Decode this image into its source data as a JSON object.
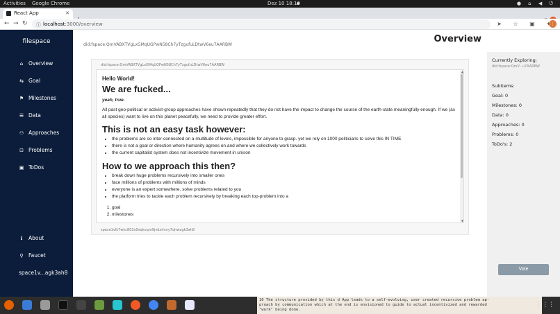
{
  "os": {
    "activities": "Activities",
    "app_name": "Google Chrome",
    "clock": "Dez 10  18:10"
  },
  "browser": {
    "tab_title": "React App",
    "url_host": "localhost",
    "url_path": ":3000/overview"
  },
  "sidebar": {
    "brand": "filespace",
    "items": [
      {
        "label": "Overview",
        "icon": "home-icon"
      },
      {
        "label": "Goal",
        "icon": "goal-icon"
      },
      {
        "label": "Milestones",
        "icon": "milestones-icon"
      },
      {
        "label": "Data",
        "icon": "data-icon"
      },
      {
        "label": "Approaches",
        "icon": "approaches-icon"
      },
      {
        "label": "Problems",
        "icon": "problems-icon"
      },
      {
        "label": "ToDos",
        "icon": "todos-icon"
      }
    ],
    "bottom": [
      {
        "label": "About",
        "icon": "info-icon"
      },
      {
        "label": "Faucet",
        "icon": "faucet-icon"
      }
    ],
    "account": "space1v...agk3ah8"
  },
  "header": {
    "did": "did:fspace:QmVABXTVgLxGMqUGPwN58Ch7yTzgufuLDtwV6eu7AARBW",
    "title": "Overview"
  },
  "card": {
    "did": "did:fspace:QmVABXTVgLxGMqUGPwN58Ch7yTzgufuLDtwV6eu7AARBW",
    "footer": "space1vlk7wkc803x0xqkvqm9jvdxlmny7qhwagk3ah8",
    "content": {
      "h_hello": "Hello World!",
      "h_fucked": "We are fucked...",
      "em": "yeah, true.",
      "p1": "All past geo-political or activist-group approaches have shown repeatedly that they do not have the impact to change the course of the earth-state meaningfully enough. If we (as all species) want to live on this planet peacefully, we need to provide greater effort.",
      "h_not_easy": "This is not an easy task however:",
      "list1": [
        "the problems are so inter-connected on a multitude of levels, impossible for anyone to grasp. yet we rely on 1000 politicians to solve this IN TIME",
        "there is not a goal or direction where humanity agrees on and where we collectively work towards",
        "the current capitalist system does not incentivize movement in unison"
      ],
      "h_approach": "How to we approach this then?",
      "list2": [
        "break down huge problems recursively into smaller ones",
        "face millions of problems with millions of minds",
        "everyone is an expert somewhere, solve problems related to you",
        "the platform tries to tackle each problem recursively by breaking each top-problem into a"
      ],
      "list3": [
        "goal",
        "milestones"
      ]
    }
  },
  "right_panel": {
    "title": "Currently Exploring:",
    "did": "did:fspace:QmV...u7AARBW",
    "stats": [
      "Subitems:",
      "Goal: 0",
      "Milestones: 0",
      "Data: 0",
      "Approaches: 0",
      "Problems: 0",
      "ToDo's: 2"
    ],
    "vote_label": "Vote"
  },
  "terminal": {
    "lines": [
      "10 The structure provided by this d App leads to a self-evolving, user created recursive problem ap-",
      "   proach by communication which at the end is envisioned to guide to actual incentivized and rewarded",
      "   \"work\" being done."
    ]
  },
  "colors": {
    "sidebar_bg": "#0b1d3a",
    "vote_bg": "#8a9aa6",
    "right_panel_bg": "#f0f0f0",
    "ubuntu_orange": "#e95420"
  }
}
